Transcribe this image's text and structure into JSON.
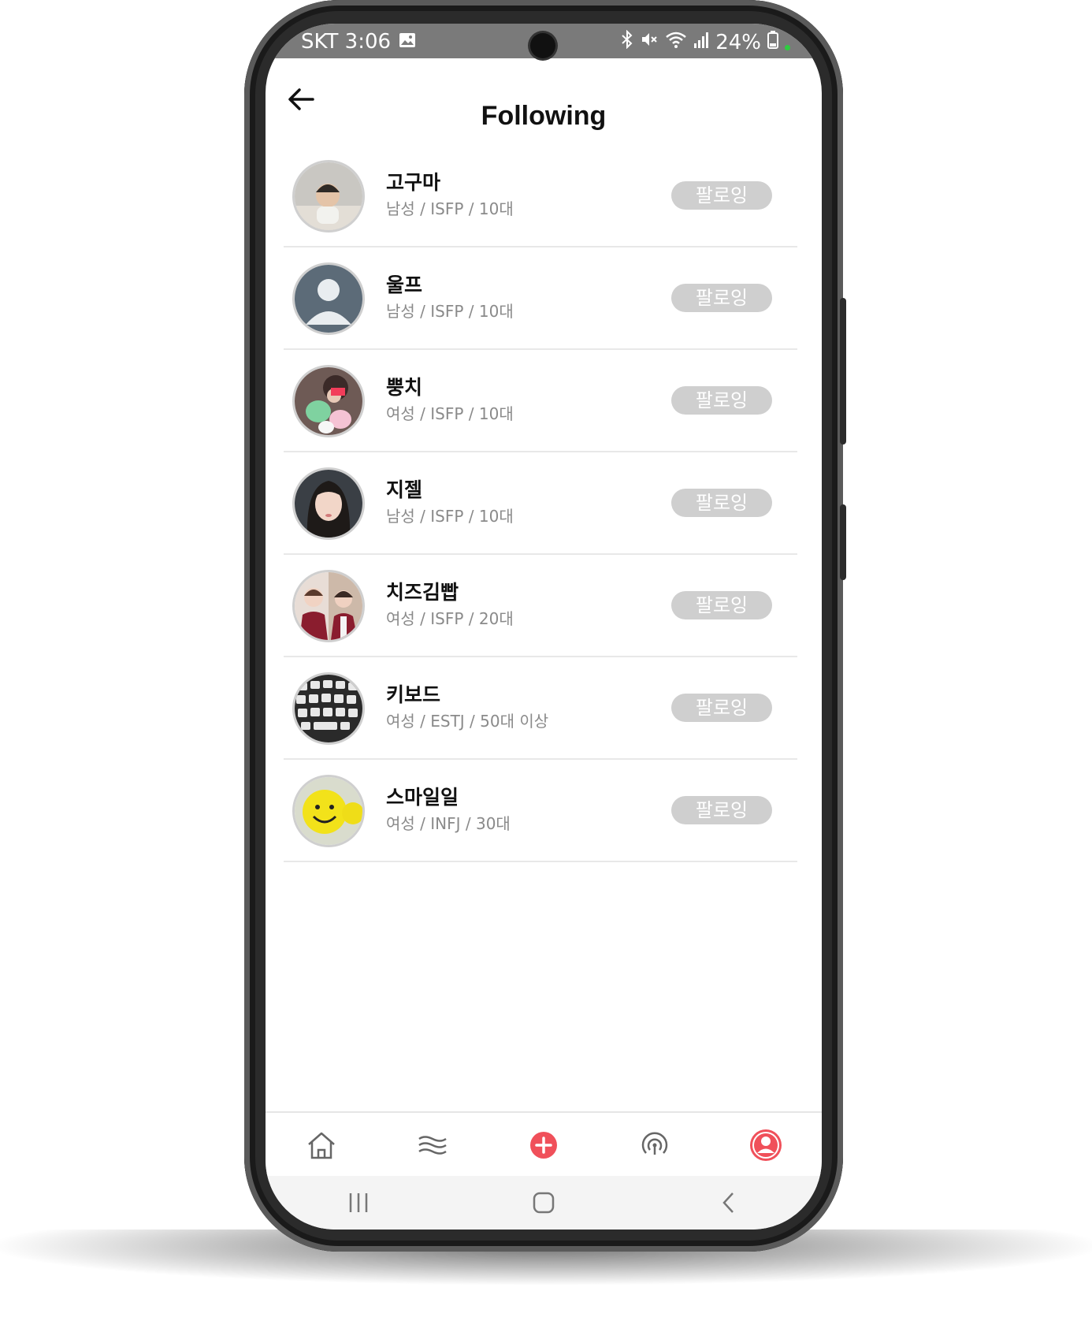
{
  "status_bar": {
    "carrier_time": "SKT 3:06",
    "battery": "24%",
    "icons": [
      "image-icon",
      "bluetooth-icon",
      "mute-icon",
      "wifi-icon",
      "signal-icon",
      "battery-icon"
    ]
  },
  "header": {
    "title": "Following",
    "back_icon": "arrow-left-icon"
  },
  "users": [
    {
      "name": "고구마",
      "meta": "남성 / ISFP / 10대",
      "button": "팔로잉",
      "avatar": "baby-photo"
    },
    {
      "name": "울프",
      "meta": "남성 / ISFP / 10대",
      "button": "팔로잉",
      "avatar": "default-person-icon"
    },
    {
      "name": "뿡치",
      "meta": "여성 / ISFP / 10대",
      "button": "팔로잉",
      "avatar": "plush-photo"
    },
    {
      "name": "지젤",
      "meta": "남성 / ISFP / 10대",
      "button": "팔로잉",
      "avatar": "portrait-photo"
    },
    {
      "name": "치즈김빱",
      "meta": "여성 / ISFP / 20대",
      "button": "팔로잉",
      "avatar": "students-photo"
    },
    {
      "name": "키보드",
      "meta": "여성 / ESTJ / 50대 이상",
      "button": "팔로잉",
      "avatar": "keyboard-photo"
    },
    {
      "name": "스마일일",
      "meta": "여성 / INFJ / 30대",
      "button": "팔로잉",
      "avatar": "smiley-photo"
    }
  ],
  "bottom_nav": [
    "home-icon",
    "feed-icon",
    "add-icon",
    "broadcast-icon",
    "profile-icon"
  ],
  "system_nav": [
    "recents-icon",
    "home-circle-icon",
    "back-chevron-icon"
  ],
  "colors": {
    "accent": "#f0505a",
    "button_bg": "#cfcfcf",
    "status_bar": "#7a7a7a"
  }
}
